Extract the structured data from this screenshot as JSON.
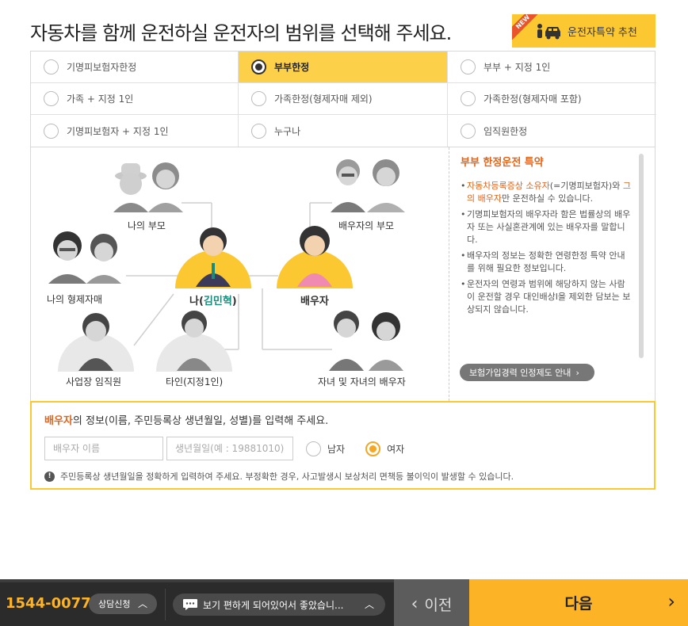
{
  "header": {
    "title": "자동차를 함께 운전하실 운전자의 범위를 선택해 주세요.",
    "recommend_label": "운전자특약 추천",
    "new_badge": "NEW"
  },
  "scope_options": [
    {
      "label": "기명피보험자한정",
      "selected": false
    },
    {
      "label": "부부한정",
      "selected": true
    },
    {
      "label": "부부 + 지정 1인",
      "selected": false
    },
    {
      "label": "가족 + 지정 1인",
      "selected": false
    },
    {
      "label": "가족한정(형제자매 제외)",
      "selected": false
    },
    {
      "label": "가족한정(형제자매 포함)",
      "selected": false
    },
    {
      "label": "기명피보험자 + 지정 1인",
      "selected": false
    },
    {
      "label": "누구나",
      "selected": false
    },
    {
      "label": "임직원한정",
      "selected": false
    }
  ],
  "diagram": {
    "my_parents": "나의 부모",
    "spouse_parents": "배우자의 부모",
    "siblings": "나의 형제자매",
    "me_prefix": "나(",
    "me_name": "김민혁",
    "me_suffix": ")",
    "spouse": "배우자",
    "employee": "사업장 임직원",
    "other": "타인(지정1인)",
    "children": "자녀 및 자녀의 배우자"
  },
  "info": {
    "title": "부부 한정운전 특약",
    "item1_a": "자동차등록증상 소유자",
    "item1_b": "(=기명피보험자)와 ",
    "item1_c": "그의 배우자",
    "item1_d": "만 운전하실 수 있습니다.",
    "item2": "기명피보험자의 배우자라 함은 법률상의 배우자 또는 사실혼관계에 있는 배우자를 말합니다.",
    "item3": "배우자의 정보는 정확한 연령한정 특약 안내를 위해 필요한 정보입니다.",
    "item4": "운전자의 연령과 범위에 해당하지 않는 사람이 운전할 경우 대인배상I을 제외한 담보는 보상되지 않습니다.",
    "guide_button": "보험가입경력 인정제도 안내"
  },
  "spouse_form": {
    "heading_highlight": "배우자",
    "heading_rest": "의 정보(이름, 주민등록상 생년월일, 성별)를 입력해 주세요.",
    "name_placeholder": "배우자 이름",
    "birth_placeholder": "생년월일(예 : 19881010)",
    "male_label": "남자",
    "female_label": "여자",
    "notice": "주민등록상 생년월일을 정확하게 입력하여 주세요. 부정확한 경우, 사고발생시 보상처리 면책등 불이익이 발생할 수 있습니다."
  },
  "bottom_bar": {
    "phone": "1544-0077",
    "consult_label": "상담신청",
    "chat_text": "보기 편하게 되어있어서 좋았습니...",
    "prev_label": "이전",
    "next_label": "다음"
  }
}
